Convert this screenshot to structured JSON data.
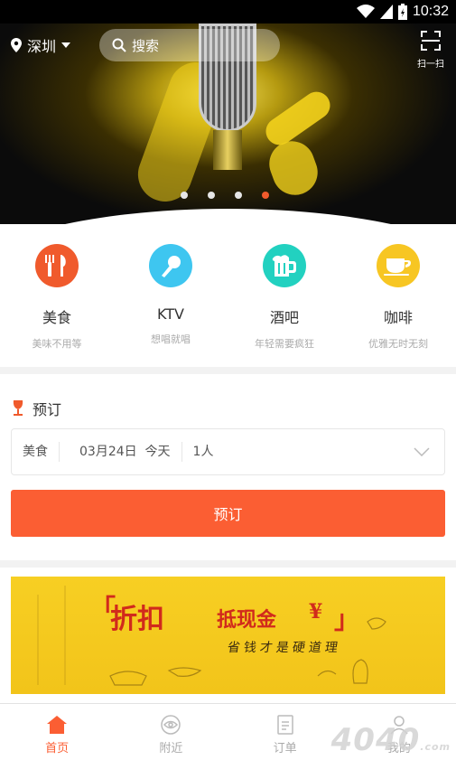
{
  "status_bar": {
    "time": "10:32"
  },
  "header": {
    "city": "深圳",
    "search_placeholder": "搜索",
    "scan_label": "扫一扫"
  },
  "banner": {
    "slide_count": 4,
    "active_slide": 4
  },
  "categories": [
    {
      "name": "美食",
      "subtitle": "美味不用等",
      "color": "#f05a2c",
      "icon": "fork-knife-icon"
    },
    {
      "name": "KTV",
      "subtitle": "想唱就唱",
      "color": "#3ec6f0",
      "icon": "microphone-icon"
    },
    {
      "name": "酒吧",
      "subtitle": "年轻需要疯狂",
      "color": "#22d1c0",
      "icon": "beer-mug-icon"
    },
    {
      "name": "咖啡",
      "subtitle": "优雅无时无刻",
      "color": "#f7c623",
      "icon": "coffee-cup-icon"
    }
  ],
  "booking": {
    "title": "预订",
    "category_value": "美食",
    "date_value": "03月24日",
    "day_value": "今天",
    "people_value": "1人",
    "submit_label": "预订"
  },
  "promo": {
    "headline": "折扣",
    "subheadline": "抵现金",
    "currency": "¥",
    "slogan": "省钱才是硬道理"
  },
  "tabbar": [
    {
      "label": "首页",
      "icon": "home-icon",
      "active": true
    },
    {
      "label": "附近",
      "icon": "eye-icon",
      "active": false
    },
    {
      "label": "订单",
      "icon": "document-icon",
      "active": false
    },
    {
      "label": "我的",
      "icon": "user-icon",
      "active": false
    }
  ],
  "watermark": {
    "text": "4040",
    "suffix": ".com"
  },
  "colors": {
    "accent": "#fb5e33",
    "promo_bg": "#f7cf23"
  }
}
